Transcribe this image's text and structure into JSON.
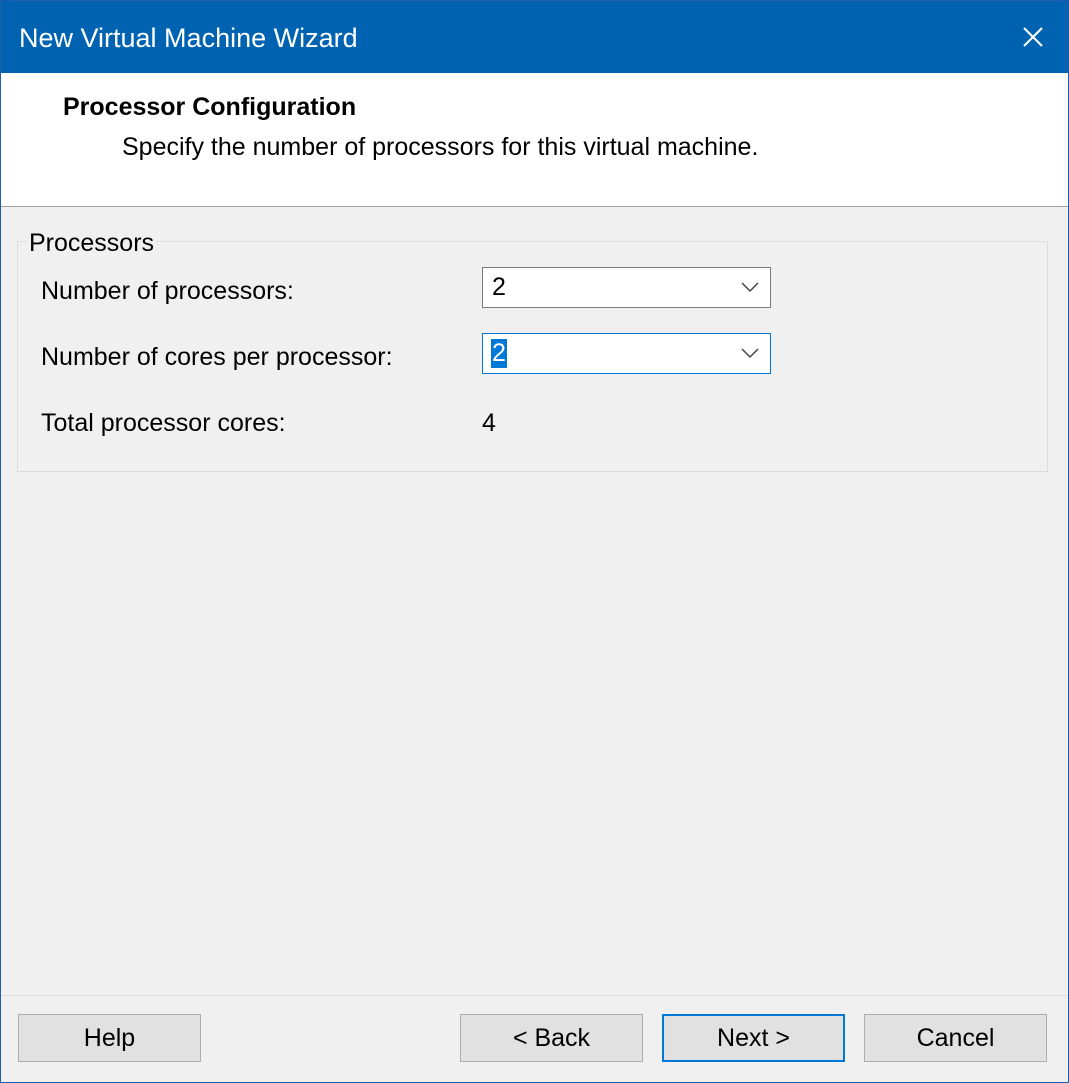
{
  "window": {
    "title": "New Virtual Machine Wizard",
    "close_icon": "close-icon"
  },
  "header": {
    "title": "Processor Configuration",
    "subtitle": "Specify the number of processors for this virtual machine."
  },
  "processors": {
    "group_label": "Processors",
    "num_processors_label": "Number of processors:",
    "num_processors_value": "2",
    "cores_per_processor_label": "Number of cores per processor:",
    "cores_per_processor_value": "2",
    "total_cores_label": "Total processor cores:",
    "total_cores_value": "4"
  },
  "buttons": {
    "help": "Help",
    "back": "< Back",
    "next": "Next >",
    "cancel": "Cancel"
  },
  "colors": {
    "titlebar": "#0063b1",
    "accent": "#0078d7",
    "dialog_bg": "#f0f0f0"
  }
}
